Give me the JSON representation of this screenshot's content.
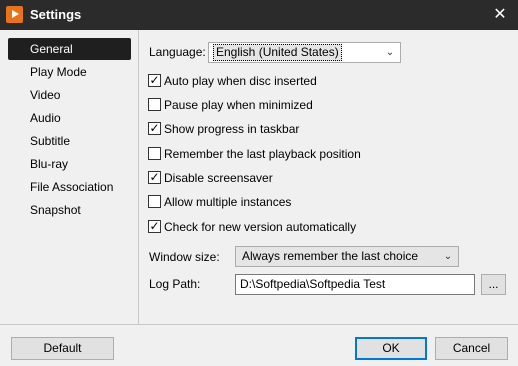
{
  "window": {
    "title": "Settings",
    "close_icon": "✕"
  },
  "sidebar": {
    "items": [
      {
        "label": "General",
        "active": true
      },
      {
        "label": "Play Mode"
      },
      {
        "label": "Video"
      },
      {
        "label": "Audio"
      },
      {
        "label": "Subtitle"
      },
      {
        "label": "Blu-ray"
      },
      {
        "label": "File Association"
      },
      {
        "label": "Snapshot"
      }
    ]
  },
  "general": {
    "language_label": "Language:",
    "language_value": "English (United States)",
    "checkboxes": [
      {
        "label": "Auto play when disc inserted",
        "checked": true
      },
      {
        "label": "Pause play when minimized",
        "checked": false
      },
      {
        "label": "Show progress in taskbar",
        "checked": true
      },
      {
        "label": "Remember the last playback position",
        "checked": false
      },
      {
        "label": "Disable screensaver",
        "checked": true
      },
      {
        "label": "Allow multiple instances",
        "checked": false
      },
      {
        "label": "Check for new version automatically",
        "checked": true
      }
    ],
    "window_size_label": "Window size:",
    "window_size_value": "Always remember the last choice",
    "log_path_label": "Log Path:",
    "log_path_value": "D:\\Softpedia\\Softpedia Test",
    "browse_label": "..."
  },
  "footer": {
    "default_label": "Default",
    "ok_label": "OK",
    "cancel_label": "Cancel"
  },
  "icons": {
    "checkmark": "✓",
    "dropdown": "⌄"
  },
  "colors": {
    "titlebar": "#2b2b2b",
    "app_icon": "#e8731a",
    "active_nav": "#1f1f1f",
    "focus_border": "#0078d7"
  }
}
